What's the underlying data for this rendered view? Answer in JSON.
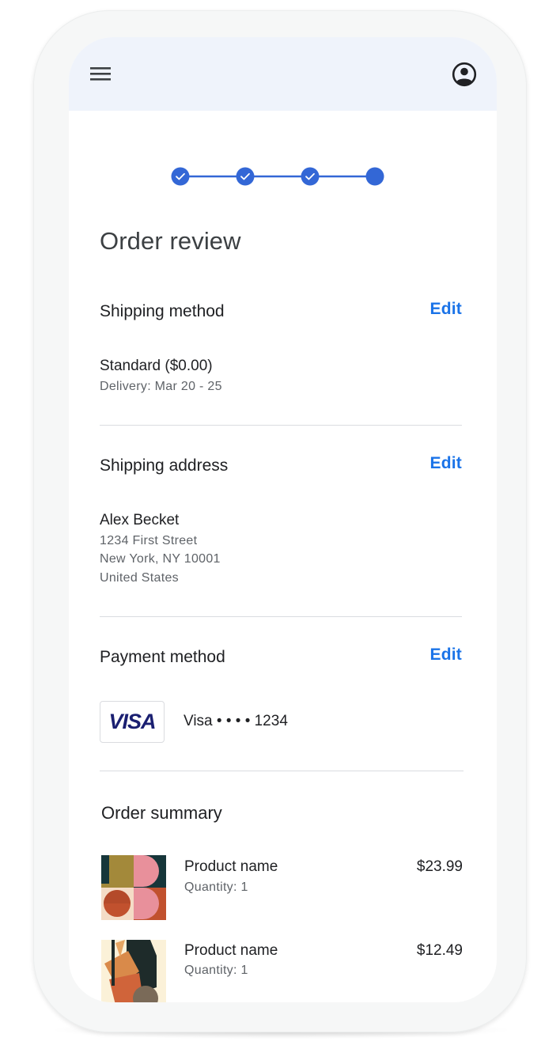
{
  "header": {
    "menu_icon": "hamburger-menu-icon",
    "account_icon": "account-circle-icon",
    "background": "#eff3fb"
  },
  "stepper": {
    "total_steps": 4,
    "completed_steps": 3,
    "current_step": 4,
    "color": "#3367d6"
  },
  "page": {
    "title": "Order review"
  },
  "shipping_method": {
    "heading": "Shipping method",
    "edit_label": "Edit",
    "option": "Standard ($0.00)",
    "delivery": "Delivery: Mar 20 - 25"
  },
  "shipping_address": {
    "heading": "Shipping address",
    "edit_label": "Edit",
    "name": "Alex Becket",
    "line1": "1234 First Street",
    "line2": "New York, NY 10001",
    "country": "United States"
  },
  "payment_method": {
    "heading": "Payment method",
    "edit_label": "Edit",
    "card_brand_logo": "VISA",
    "card_label": "Visa • • • • 1234"
  },
  "order_summary": {
    "heading": "Order summary",
    "items": [
      {
        "name": "Product name",
        "quantity": "Quantity: 1",
        "price": "$23.99"
      },
      {
        "name": "Product name",
        "quantity": "Quantity: 1",
        "price": "$12.49"
      }
    ]
  },
  "colors": {
    "accent": "#1a73e8",
    "text_primary": "#202124",
    "text_secondary": "#5f6368",
    "divider": "#dadce0"
  }
}
